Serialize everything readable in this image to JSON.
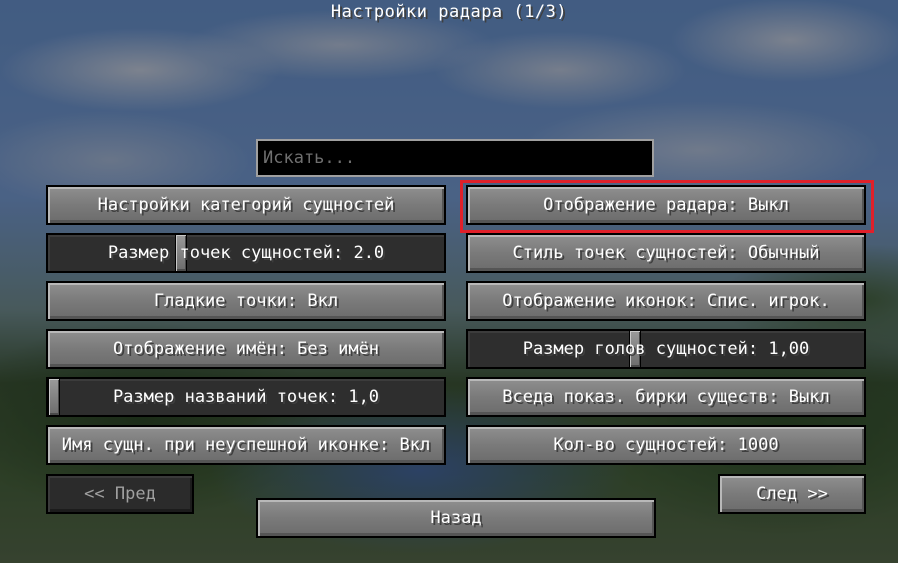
{
  "title": "Настройки радара (1/3)",
  "search": {
    "placeholder": "Искать..."
  },
  "left_column": {
    "entity_category_settings": "Настройки категорий сущностей",
    "entity_dot_size": {
      "label": "Размер точек сущностей: 2.0",
      "level": 0.33
    },
    "smooth_dots": "Гладкие точки: Вкл",
    "name_display": "Отображение имён: Без имён",
    "dot_name_size": {
      "label": "Размер названий точек: 1,0",
      "level": 0.0
    },
    "name_on_failed_icon": "Имя сущн. при неуспешной иконке: Вкл"
  },
  "right_column": {
    "radar_display": "Отображение радара: Выкл",
    "dot_style": "Стиль точек сущностей: Обычный",
    "icon_display": "Отображение иконок: Спис. игрок.",
    "head_size": {
      "label": "Размер голов сущностей: 1,00",
      "level": 0.42
    },
    "always_show_nametags": "Вседа показ. бирки существ: Выкл",
    "entity_count": "Кол-во сущностей: 1000"
  },
  "navigation": {
    "prev": "<< Пред",
    "next": "След >>",
    "back": "Назад"
  },
  "colors": {
    "highlight_border": "#e0202a",
    "button_face": "#7a7a7a",
    "disabled_face": "#2b2b2b",
    "search_background": "#000000"
  }
}
